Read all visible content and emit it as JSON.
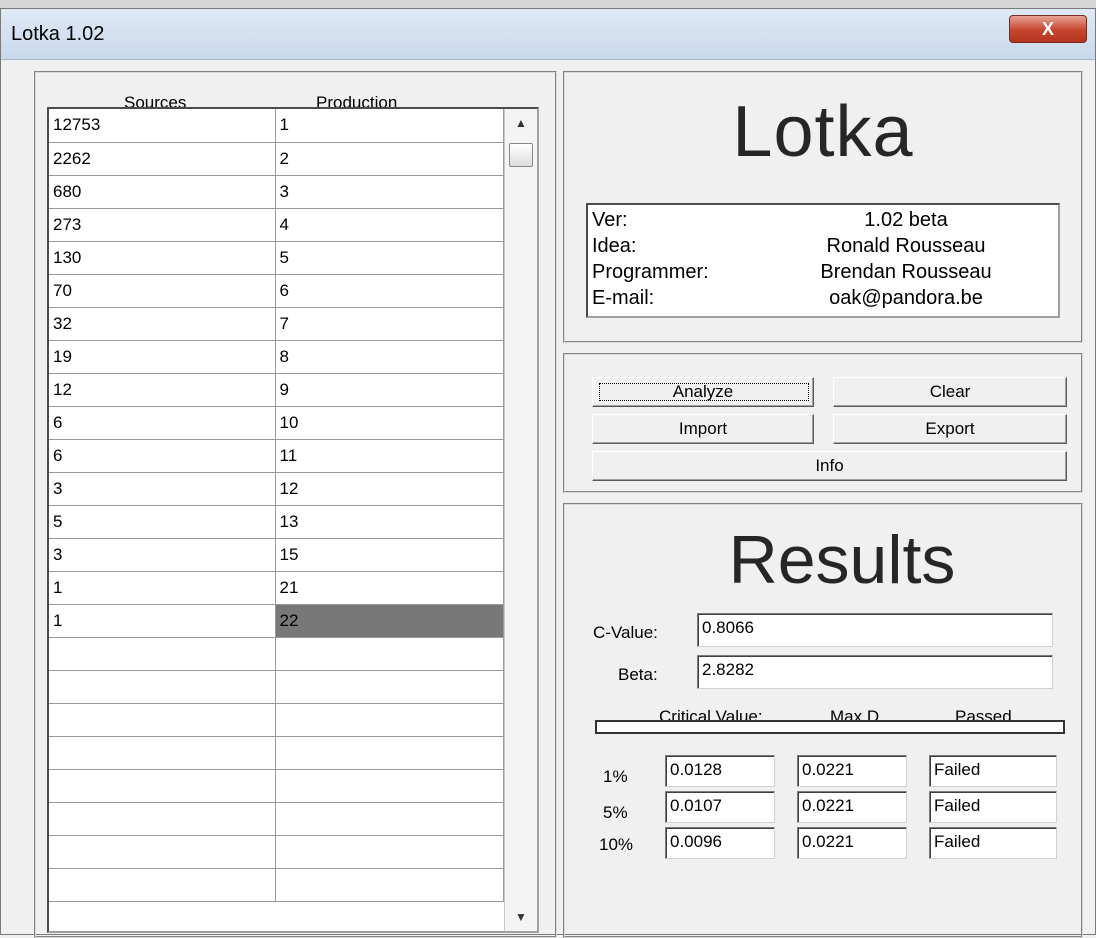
{
  "window": {
    "title": "Lotka 1.02",
    "close_glyph": "X"
  },
  "table": {
    "headers": [
      "Sources",
      "Production"
    ],
    "rows": [
      [
        "12753",
        "1"
      ],
      [
        "2262",
        "2"
      ],
      [
        "680",
        "3"
      ],
      [
        "273",
        "4"
      ],
      [
        "130",
        "5"
      ],
      [
        "70",
        "6"
      ],
      [
        "32",
        "7"
      ],
      [
        "19",
        "8"
      ],
      [
        "12",
        "9"
      ],
      [
        "6",
        "10"
      ],
      [
        "6",
        "11"
      ],
      [
        "3",
        "12"
      ],
      [
        "5",
        "13"
      ],
      [
        "3",
        "15"
      ],
      [
        "1",
        "21"
      ],
      [
        "1",
        "22"
      ],
      [
        "",
        ""
      ],
      [
        "",
        ""
      ],
      [
        "",
        ""
      ],
      [
        "",
        ""
      ],
      [
        "",
        ""
      ],
      [
        "",
        ""
      ],
      [
        "",
        ""
      ],
      [
        "",
        ""
      ]
    ],
    "selected_row": 15,
    "scroll_up_icon": "scroll-up-arrow-icon",
    "scroll_down_icon": "scroll-down-arrow-icon"
  },
  "about": {
    "logo": "Lotka",
    "rows": [
      {
        "label": "Ver:",
        "value": "1.02 beta"
      },
      {
        "label": "Idea:",
        "value": "Ronald Rousseau"
      },
      {
        "label": "Programmer:",
        "value": "Brendan Rousseau"
      },
      {
        "label": "E-mail:",
        "value": "oak@pandora.be"
      }
    ]
  },
  "buttons": {
    "analyze": "Analyze",
    "clear": "Clear",
    "import": "Import",
    "export": "Export",
    "info": "Info"
  },
  "results": {
    "heading": "Results",
    "c_label": "C-Value:",
    "c_value": "0.8066",
    "beta_label": "Beta:",
    "beta_value": "2.8282",
    "col_headers": [
      "Critical Value:",
      "Max D",
      "Passed"
    ],
    "rows": [
      {
        "level": "1%",
        "critical": "0.0128",
        "maxd": "0.0221",
        "passed": "Failed"
      },
      {
        "level": "5%",
        "critical": "0.0107",
        "maxd": "0.0221",
        "passed": "Failed"
      },
      {
        "level": "10%",
        "critical": "0.0096",
        "maxd": "0.0221",
        "passed": "Failed"
      }
    ]
  }
}
